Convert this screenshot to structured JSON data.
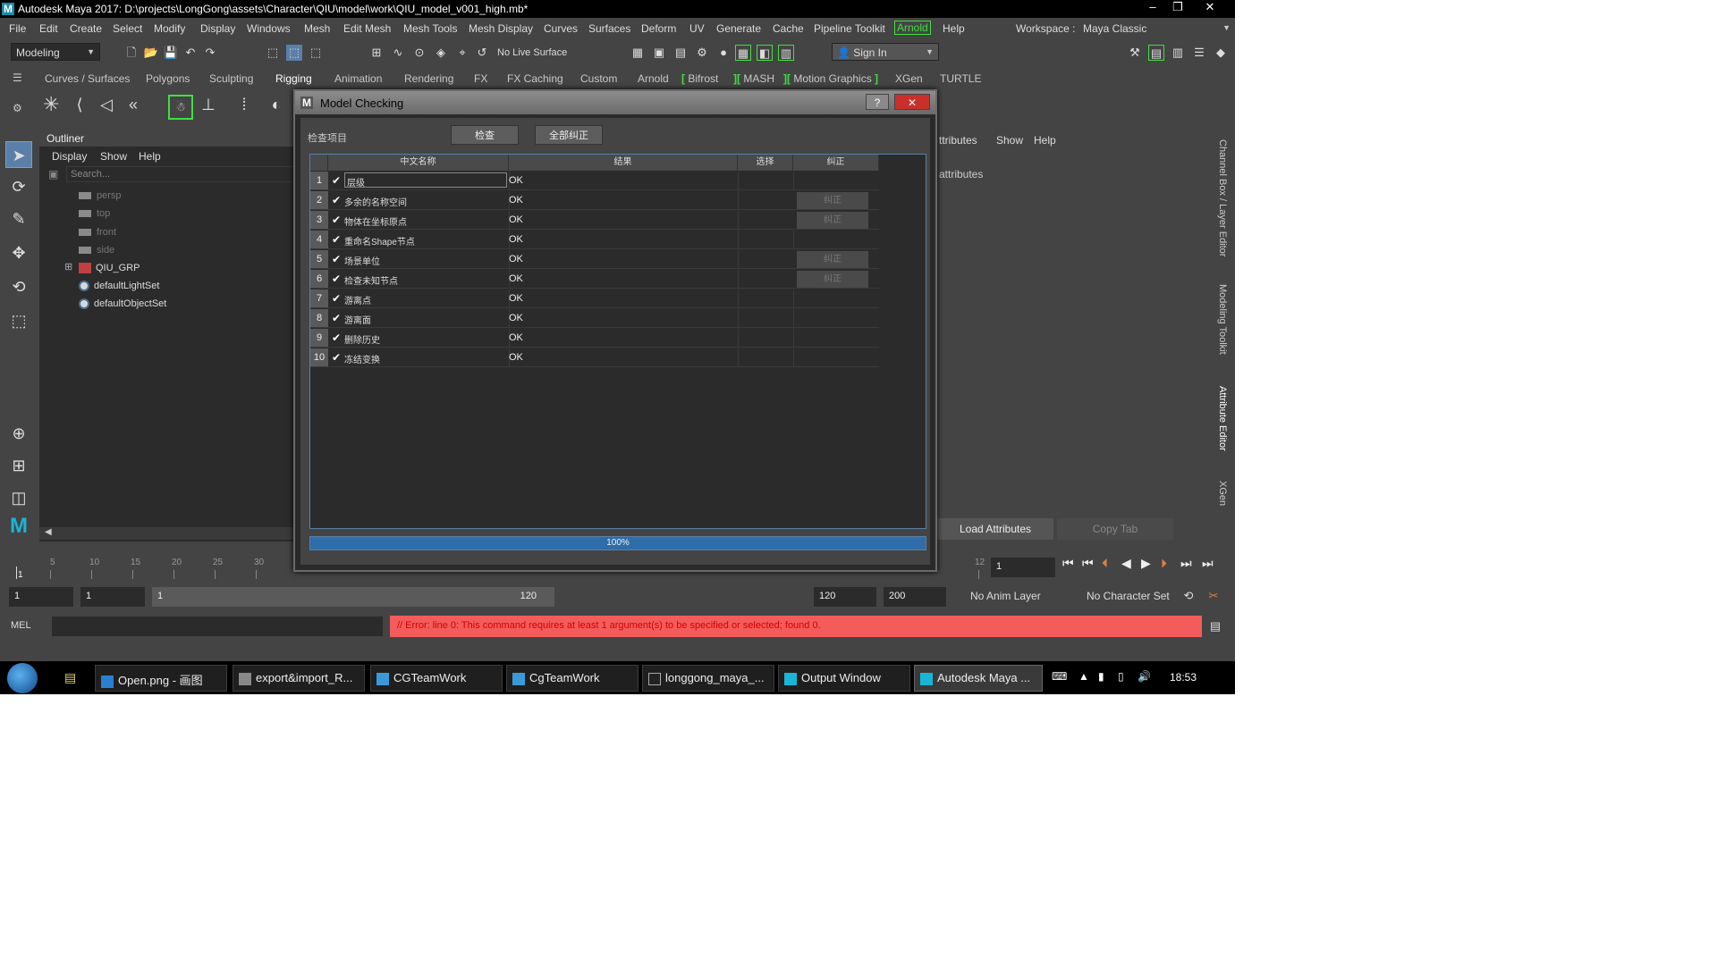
{
  "window": {
    "title": "Autodesk Maya 2017: D:\\projects\\LongGong\\assets\\Character\\QIU\\model\\work\\QIU_model_v001_high.mb*",
    "min": "–",
    "max": "❐",
    "close": "✕"
  },
  "menubar": {
    "items": [
      "File",
      "Edit",
      "Create",
      "Select",
      "Modify",
      "Display",
      "Windows",
      "Mesh",
      "Edit Mesh",
      "Mesh Tools",
      "Mesh Display",
      "Curves",
      "Surfaces",
      "Deform",
      "UV",
      "Generate",
      "Cache",
      "Pipeline Toolkit",
      "Arnold",
      "Help"
    ],
    "workspace_label": "Workspace :",
    "workspace_value": "Maya Classic"
  },
  "statusline": {
    "mode": "Modeling",
    "live_surface": "No Live Surface",
    "sign_in": "Sign In"
  },
  "shelf": {
    "tabs": [
      "Curves / Surfaces",
      "Polygons",
      "Sculpting",
      "Rigging",
      "Animation",
      "Rendering",
      "FX",
      "FX Caching",
      "Custom",
      "Arnold",
      "Bifrost",
      "MASH",
      "Motion Graphics",
      "XGen",
      "TURTLE"
    ],
    "active_tab": "Rigging"
  },
  "outliner": {
    "tab": "Outliner",
    "menu": [
      "Display",
      "Show",
      "Help"
    ],
    "search_placeholder": "Search...",
    "items": [
      "persp",
      "top",
      "front",
      "side",
      "QIU_GRP",
      "defaultLightSet",
      "defaultObjectSet"
    ]
  },
  "attribute_editor": {
    "menu_partial": "ttributes",
    "menu": [
      "Show",
      "Help"
    ],
    "placeholder_text": "attributes",
    "load_button": "Load Attributes",
    "copy_tab_button": "Copy Tab",
    "side_tabs": [
      "Channel Box / Layer Editor",
      "Modeling Toolkit",
      "Attribute Editor",
      "XGen"
    ]
  },
  "timeslider": {
    "ticks": [
      "5",
      "10",
      "15",
      "20",
      "25",
      "30",
      "12"
    ],
    "current_frame_marker": "1",
    "current_frame": "1"
  },
  "range": {
    "start": "1",
    "playback_start": "1",
    "slider_start": "1",
    "slider_end": "120",
    "playback_end": "120",
    "end": "200",
    "anim_layer": "No Anim Layer",
    "character_set": "No Character Set"
  },
  "cmdline": {
    "label": "MEL",
    "error": "// Error: line 0: This command requires at least 1 argument(s) to be specified or selected;  found 0."
  },
  "taskbar": {
    "items": [
      "Open.png - 画图",
      "export&import_R...",
      "CGTeamWork",
      "CgTeamWork",
      "longgong_maya_...",
      "Output Window",
      "Autodesk Maya ..."
    ],
    "active_index": 6,
    "clock": "18:53"
  },
  "dialog": {
    "title": "Model Checking",
    "help": "?",
    "close": "✕",
    "check_label": "检查项目",
    "check_button": "检查",
    "fix_all_button": "全部纠正",
    "columns": [
      "中文名称",
      "结果",
      "选择",
      "纠正"
    ],
    "rows": [
      {
        "num": "1",
        "name": "层级",
        "result": "OK",
        "fix": ""
      },
      {
        "num": "2",
        "name": "多余的名称空间",
        "result": "OK",
        "fix": "纠正"
      },
      {
        "num": "3",
        "name": "物体在坐标原点",
        "result": "OK",
        "fix": "纠正"
      },
      {
        "num": "4",
        "name": "重命名Shape节点",
        "result": "OK",
        "fix": ""
      },
      {
        "num": "5",
        "name": "场景单位",
        "result": "OK",
        "fix": "纠正"
      },
      {
        "num": "6",
        "name": "检查未知节点",
        "result": "OK",
        "fix": "纠正"
      },
      {
        "num": "7",
        "name": "游离点",
        "result": "OK",
        "fix": ""
      },
      {
        "num": "8",
        "name": "游离面",
        "result": "OK",
        "fix": ""
      },
      {
        "num": "9",
        "name": "删除历史",
        "result": "OK",
        "fix": ""
      },
      {
        "num": "10",
        "name": "冻结变换",
        "result": "OK",
        "fix": ""
      }
    ],
    "progress": "100%",
    "progress_value": 1.0
  },
  "colors": {
    "error_bg": "#f45c5c",
    "error_text": "#d00000",
    "accent_blue": "#5b7fa6",
    "arnold_green": "#3ee03e"
  }
}
